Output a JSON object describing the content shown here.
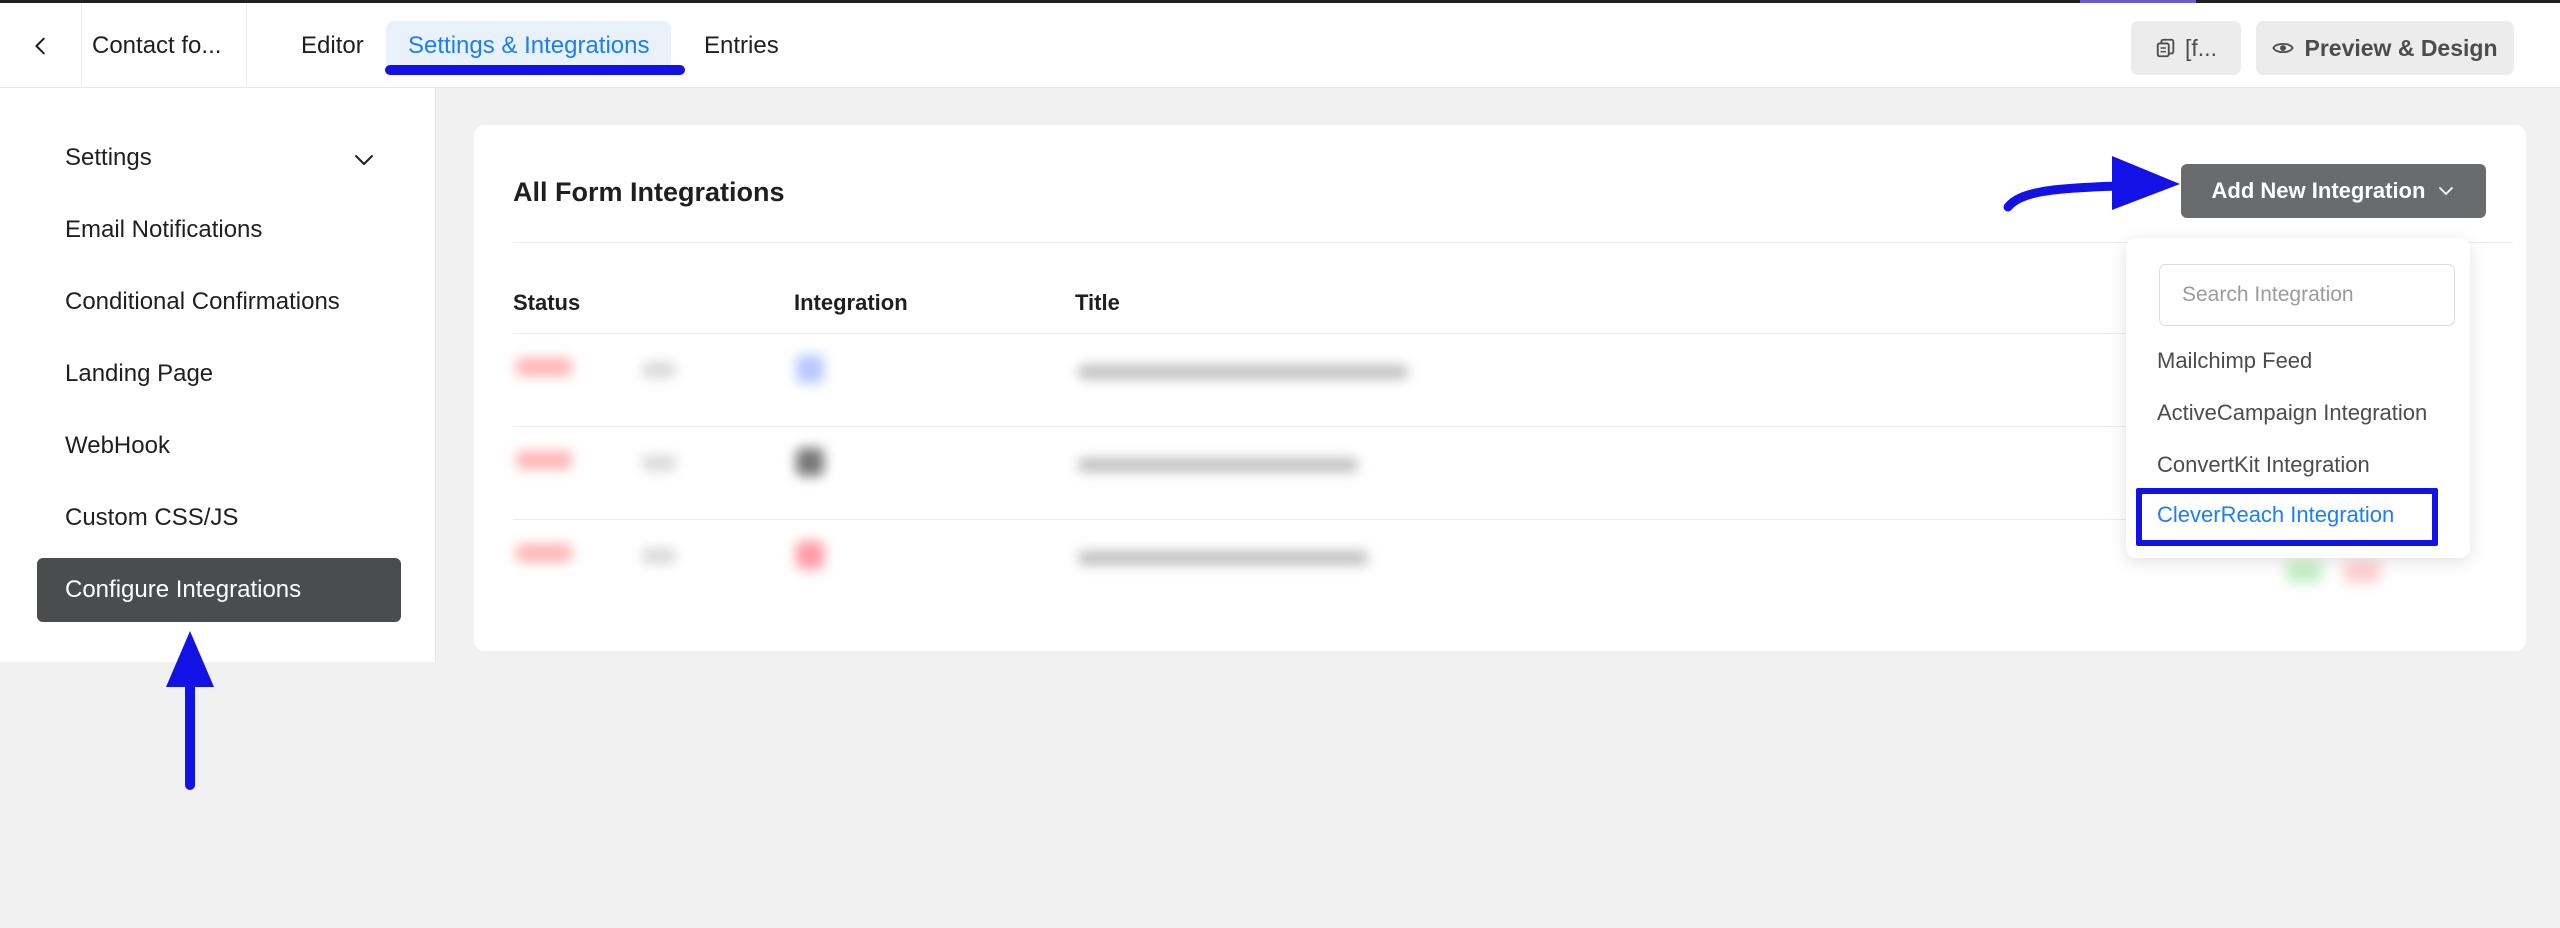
{
  "header": {
    "back_icon": "chevron-left-icon",
    "form_name": "Contact fo...",
    "tabs": [
      {
        "label": "Editor"
      },
      {
        "label": "Settings & Integrations"
      },
      {
        "label": "Entries"
      }
    ],
    "shortcode_label": "[f...",
    "preview_label": "Preview & Design"
  },
  "sidebar": {
    "items": [
      {
        "label": "Settings"
      },
      {
        "label": "Email Notifications"
      },
      {
        "label": "Conditional Confirmations"
      },
      {
        "label": "Landing Page"
      },
      {
        "label": "WebHook"
      },
      {
        "label": "Custom CSS/JS"
      },
      {
        "label": "Configure Integrations"
      }
    ]
  },
  "main": {
    "title": "All Form Integrations",
    "add_button_label": "Add New Integration",
    "columns": [
      "Status",
      "Integration",
      "Title"
    ]
  },
  "dropdown": {
    "search_placeholder": "Search Integration",
    "items": [
      {
        "label": "Mailchimp Feed"
      },
      {
        "label": "ActiveCampaign Integration"
      },
      {
        "label": "ConvertKit Integration"
      },
      {
        "label": "CleverReach Integration"
      }
    ]
  },
  "colors": {
    "accent": "#1a7efb",
    "annotation": "#1212e6",
    "active_sidebar": "#4b4c4d"
  }
}
